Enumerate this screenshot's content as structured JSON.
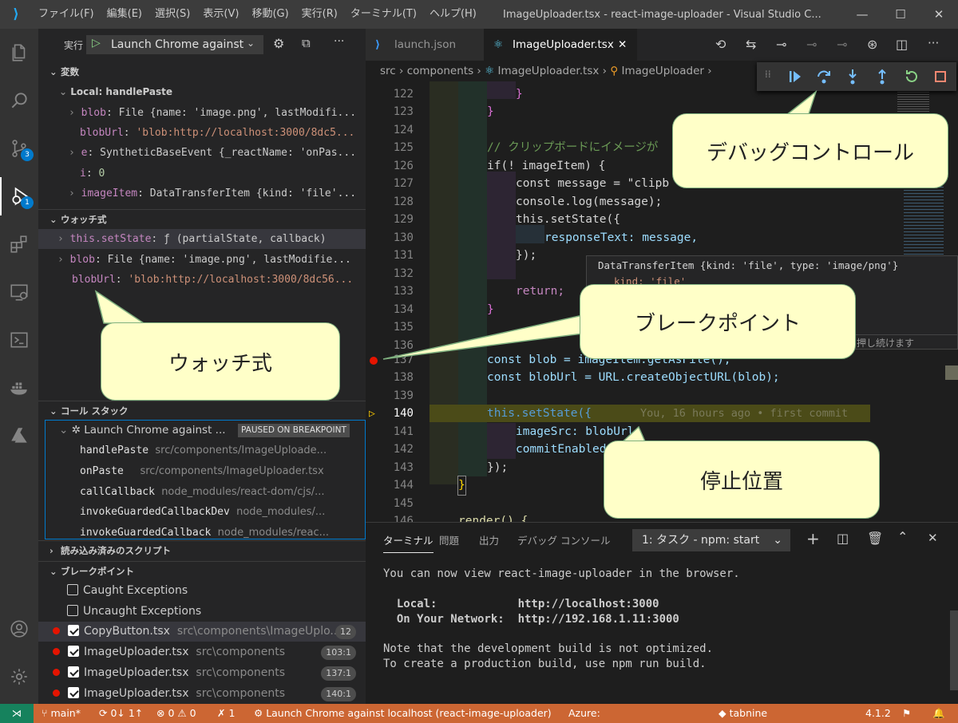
{
  "window": {
    "title": "ImageUploader.tsx - react-image-uploader - Visual Studio C...",
    "menu": [
      "ファイル(F)",
      "編集(E)",
      "選択(S)",
      "表示(V)",
      "移動(G)",
      "実行(R)",
      "ターミナル(T)",
      "ヘルプ(H)"
    ]
  },
  "activity": {
    "scm_badge": "3",
    "debug_badge": "1"
  },
  "debug_header": {
    "run_label": "実行",
    "config": "Launch Chrome against"
  },
  "variables": {
    "title": "変数",
    "scope": "Local: handlePaste",
    "items": [
      {
        "name": "blob",
        "value": "File {name: 'image.png', lastModifi..."
      },
      {
        "name": "blobUrl",
        "value": "'blob:http://localhost:3000/8dc5..."
      },
      {
        "name": "e",
        "value": "SyntheticBaseEvent {_reactName: 'onPas..."
      },
      {
        "name": "i",
        "value": "0"
      },
      {
        "name": "imageItem",
        "value": "DataTransferItem {kind: 'file'..."
      }
    ]
  },
  "watch": {
    "title": "ウォッチ式",
    "items": [
      {
        "name": "this.setState",
        "value": "ƒ (partialState, callback)"
      },
      {
        "name": "blob",
        "value": "File {name: 'image.png', lastModifie..."
      },
      {
        "name": "blobUrl",
        "value": "'blob:http://localhost:3000/8dc56..."
      }
    ]
  },
  "callstack": {
    "title": "コール スタック",
    "session": "Launch Chrome against ...",
    "status": "PAUSED ON BREAKPOINT",
    "frames": [
      {
        "fn": "handlePaste",
        "path": "src/components/ImageUploade..."
      },
      {
        "fn": "onPaste",
        "path": "src/components/ImageUploader.tsx"
      },
      {
        "fn": "callCallback",
        "path": "node_modules/react-dom/cjs/..."
      },
      {
        "fn": "invokeGuardedCallbackDev",
        "path": "node_modules/..."
      },
      {
        "fn": "invokeGuardedCallback",
        "path": "node_modules/reac..."
      }
    ]
  },
  "loaded_scripts": {
    "title": "読み込み済みのスクリプト"
  },
  "breakpoints": {
    "title": "ブレークポイント",
    "items": [
      {
        "label": "Caught Exceptions",
        "checked": false
      },
      {
        "label": "Uncaught Exceptions",
        "checked": false
      },
      {
        "label": "CopyButton.tsx",
        "path": "src\\components\\ImageUplo...",
        "badge": "12",
        "checked": true
      },
      {
        "label": "ImageUploader.tsx",
        "path": "src\\components",
        "badge": "103:1",
        "checked": true
      },
      {
        "label": "ImageUploader.tsx",
        "path": "src\\components",
        "badge": "137:1",
        "checked": true
      },
      {
        "label": "ImageUploader.tsx",
        "path": "src\\components",
        "badge": "140:1",
        "checked": true
      }
    ]
  },
  "tabs": [
    {
      "label": "launch.json",
      "active": false
    },
    {
      "label": "ImageUploader.tsx",
      "active": true
    }
  ],
  "breadcrumb": [
    "src",
    "components",
    "ImageUploader.tsx",
    "ImageUploader"
  ],
  "code": {
    "line_numbers": [
      "122",
      "123",
      "124",
      "125",
      "126",
      "127",
      "128",
      "129",
      "130",
      "131",
      "132",
      "133",
      "134",
      "135",
      "136",
      "137",
      "138",
      "139",
      "140",
      "141",
      "142",
      "143",
      "144",
      "145",
      "146"
    ],
    "comment_125": "// クリップボードにイメージが",
    "if_126": "if(! imageItem) {",
    "message_127": "const message = \"clipb",
    "log_128": "console.log(message);",
    "setstate_129": "this.setState({",
    "resp_130": "responseText: message,",
    "close_131": "});",
    "return_133": "return;",
    "blob_137": "const blob = imageItem.getAsFile();",
    "bloburl_138": "const blobUrl = URL.createObjectURL(blob);",
    "setstate_140": "this.setState({",
    "blame_140": "You, 16 hours ago • first commit",
    "imgsrc_141": "imageSrc: blobUrl,",
    "commit_142": "commitEnabled",
    "close_143": "});",
    "render_146": "render() {"
  },
  "hover": {
    "text": "DataTransferItem {kind: 'file', type: 'image/png'}",
    "kind_line": "kind: 'file'",
    "hint": "押し続けます"
  },
  "panel": {
    "tabs": [
      "ターミナル",
      "問題",
      "出力",
      "デバッグ コンソール"
    ],
    "task": "1: タスク - npm: start",
    "lines": [
      "You can now view react-image-uploader in the browser.",
      "",
      "  Local:            http://localhost:3000",
      "  On Your Network:  http://192.168.1.11:3000",
      "",
      "Note that the development build is not optimized.",
      "To create a production build, use npm run build."
    ]
  },
  "status": {
    "branch": "main*",
    "sync": "0↓ 1↑",
    "errors": "0",
    "warnings": "0",
    "debug_count": "1",
    "launch": "Launch Chrome against localhost (react-image-uploader)",
    "azure": "Azure:",
    "tabnine": "tabnine",
    "version": "4.1.2"
  },
  "callouts": {
    "debug_controls": "デバッグコントロール",
    "breakpoint": "ブレークポイント",
    "watch": "ウォッチ式",
    "stop_position": "停止位置"
  },
  "colors": {
    "status_bar": "#cc6633",
    "accent": "#007acc",
    "callout_fill": "#ffffc8"
  }
}
